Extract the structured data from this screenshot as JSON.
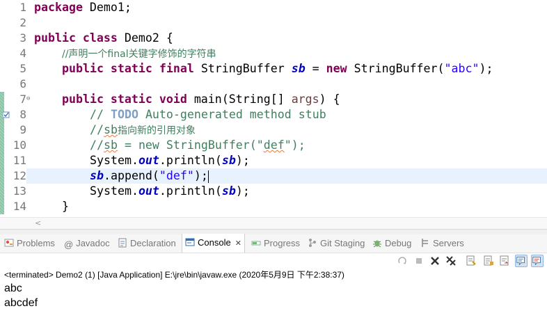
{
  "editor": {
    "lines": [
      {
        "num": "1"
      },
      {
        "num": "2"
      },
      {
        "num": "3"
      },
      {
        "num": "4"
      },
      {
        "num": "5"
      },
      {
        "num": "6"
      },
      {
        "num": "7"
      },
      {
        "num": "8"
      },
      {
        "num": "9"
      },
      {
        "num": "10"
      },
      {
        "num": "11"
      },
      {
        "num": "12"
      },
      {
        "num": "13"
      },
      {
        "num": "14"
      }
    ],
    "code": {
      "l1_kw": "package",
      "l1_rest": " Demo1;",
      "l3_kw": "public class",
      "l3_rest": " Demo2 {",
      "l4_cm": "//声明一个final关键字修饰的字符串",
      "l5_kw": "public static final",
      "l5_type": " StringBuffer ",
      "l5_var": "sb",
      "l5_eq": " = ",
      "l5_new": "new",
      "l5_rest": " StringBuffer(",
      "l5_str": "\"abc\"",
      "l5_end": ");",
      "l7_kw": "public static void",
      "l7_rest": " main(String[] ",
      "l7_par": "args",
      "l7_end": ") {",
      "l8_cm1": "// ",
      "l8_todo": "TODO",
      "l8_cm2": " Auto-generated method stub",
      "l9_cm1": "//",
      "l9_sq": "sb",
      "l9_cm2": "指向新的引用对象",
      "l10_cm1": "//",
      "l10_sq": "sb",
      "l10_cm2": " = new StringBuffer(\"",
      "l10_sq2": "def",
      "l10_cm3": "\");",
      "l11_a": "System.",
      "l11_out": "out",
      "l11_b": ".println(",
      "l11_sb": "sb",
      "l11_c": ");",
      "l12_sb": "sb",
      "l12_a": ".append(",
      "l12_str": "\"def\"",
      "l12_b": ");",
      "l13_a": "System.",
      "l13_out": "out",
      "l13_b": ".println(",
      "l13_sb": "sb",
      "l13_c": ");",
      "l14": "}"
    }
  },
  "console": {
    "tabs": [
      {
        "label": "Problems",
        "icon": "problems-icon"
      },
      {
        "label": "Javadoc",
        "icon": "at-icon"
      },
      {
        "label": "Declaration",
        "icon": "declaration-icon"
      },
      {
        "label": "Console",
        "icon": "console-icon",
        "active": true
      },
      {
        "label": "Progress",
        "icon": "progress-icon"
      },
      {
        "label": "Git Staging",
        "icon": "git-icon"
      },
      {
        "label": "Debug",
        "icon": "bug-icon"
      },
      {
        "label": "Servers",
        "icon": "servers-icon"
      }
    ],
    "close_glyph": "✕",
    "status": "<terminated> Demo2 (1) [Java Application] E:\\jre\\bin\\javaw.exe (2020年5月9日 下午2:38:37)",
    "output": [
      "abc",
      "abcdef"
    ]
  },
  "colors": {
    "keyword": "#7f0055",
    "string": "#2a00ff",
    "comment": "#3f7f5f",
    "field": "#0000c0",
    "current_line": "#e8f2fe"
  }
}
